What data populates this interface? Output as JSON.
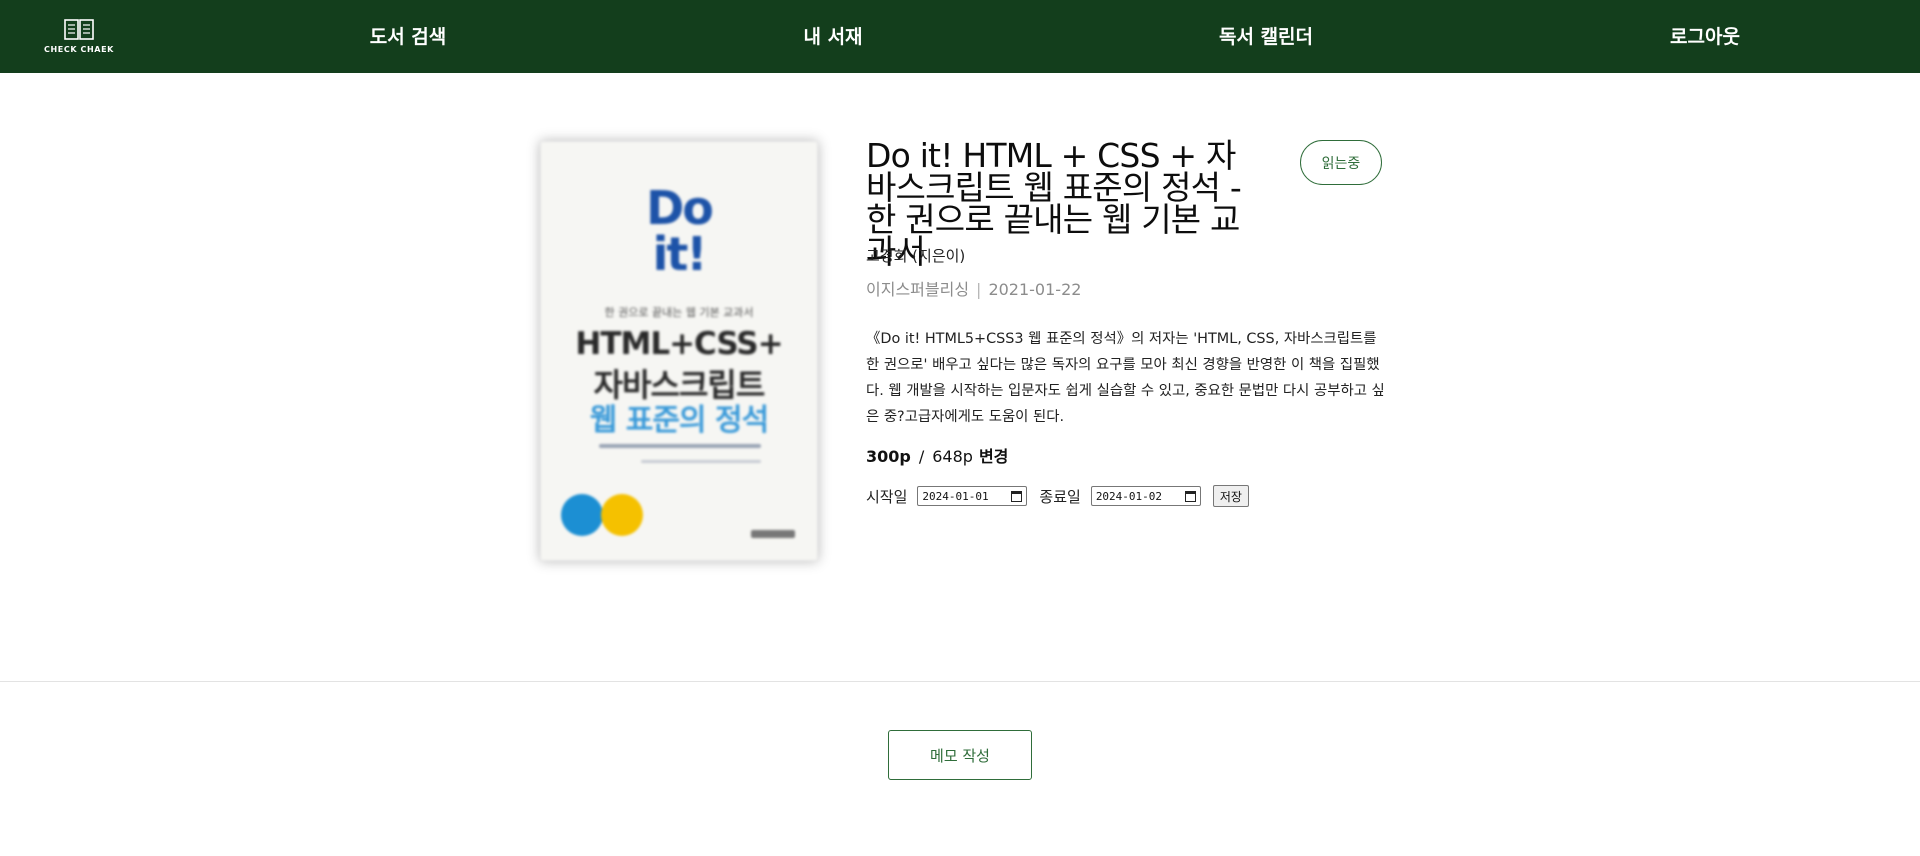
{
  "header": {
    "logo_text": "CHECK CHAEK",
    "nav": [
      {
        "label": "도서 검색"
      },
      {
        "label": "내 서재"
      },
      {
        "label": "독서 캘린더"
      },
      {
        "label": "로그아웃"
      }
    ]
  },
  "cover": {
    "small_caption": "",
    "doit_line1": "Do",
    "doit_line2": "it!",
    "subtitle": "한 권으로 끝내는 웹 기본 교과서",
    "title_line1": "HTML+CSS+",
    "title_line2": "자바스크립트",
    "title_line3": "웹 표준의 정석"
  },
  "book": {
    "title": "Do it! HTML + CSS + 자바스크립트 웹 표준의 정석 - 한 권으로 끝내는 웹 기본 교과서",
    "status": "읽는중",
    "author": "고경희 (지은이)",
    "publisher": "이지스퍼블리싱",
    "pub_date": "2021-01-22",
    "description": "《Do it! HTML5+CSS3 웹 표준의 정석》의 저자는 'HTML, CSS, 자바스크립트를 한 권으로' 배우고 싶다는 많은 독자의 요구를 모아 최신 경향을 반영한 이 책을 집필했다. 웹 개발을 시작하는 입문자도 쉽게 실습할 수 있고, 중요한 문법만 다시 공부하고 싶은 중?고급자에게도 도움이 된다."
  },
  "progress": {
    "current_page": "300p",
    "separator": "/",
    "total_pages": "648p",
    "change_label": "변경"
  },
  "dates": {
    "start_label": "시작일",
    "start_value": "2024-01-01",
    "end_label": "종료일",
    "end_value": "2024-01-02",
    "save_label": "저장"
  },
  "memo": {
    "button_label": "메모 작성"
  }
}
